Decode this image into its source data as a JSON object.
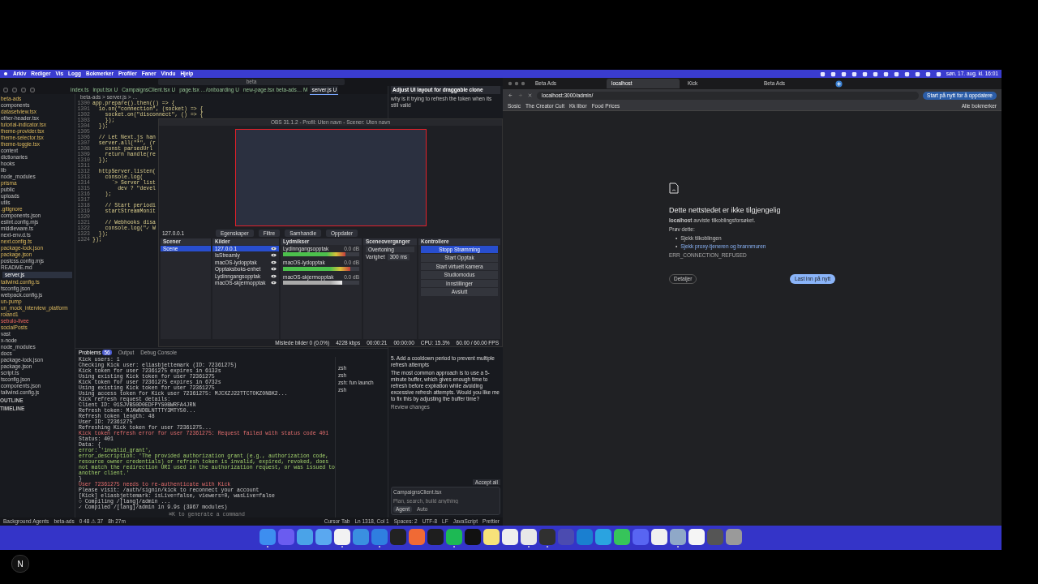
{
  "menubar": {
    "menus": [
      "Arkiv",
      "Rediger",
      "Vis",
      "Logg",
      "Bokmerker",
      "Profiler",
      "Faner",
      "Vindu",
      "Hjelp"
    ],
    "clock": "søn. 17. aug. kl. 16:01"
  },
  "editor": {
    "search": "beta",
    "tabs": [
      {
        "label": "index.ts",
        "selected": false
      },
      {
        "label": "input.tsx U",
        "selected": false
      },
      {
        "label": "CampaignsClient.tsx U",
        "selected": false
      },
      {
        "label": "page.tsx …/onboarding U",
        "selected": false
      },
      {
        "label": "new-page.tsx beta-ads… M",
        "selected": false
      },
      {
        "label": "server.js U",
        "selected": true
      }
    ],
    "breadcrumb": "beta-ads > server.js > …",
    "files": [
      {
        "name": "beta-ads",
        "kind": "modified"
      },
      {
        "name": "components",
        "kind": "plain"
      },
      {
        "name": "datasetview.tsx",
        "kind": "modified"
      },
      {
        "name": "other-header.tsx",
        "kind": "plain"
      },
      {
        "name": "tutorial-indicator.tsx",
        "kind": "modified"
      },
      {
        "name": "theme-provider.tsx",
        "kind": "modified"
      },
      {
        "name": "theme-selector.tsx",
        "kind": "modified"
      },
      {
        "name": "theme-toggle.tsx",
        "kind": "modified"
      },
      {
        "name": "context",
        "kind": "plain"
      },
      {
        "name": "dictionaries",
        "kind": "plain"
      },
      {
        "name": "hooks",
        "kind": "plain"
      },
      {
        "name": "lib",
        "kind": "plain"
      },
      {
        "name": "node_modules",
        "kind": "plain"
      },
      {
        "name": "prisma",
        "kind": "modified"
      },
      {
        "name": "public",
        "kind": "plain"
      },
      {
        "name": "uploads",
        "kind": "plain"
      },
      {
        "name": "utils",
        "kind": "plain"
      },
      {
        "name": ".gitignore",
        "kind": "modified"
      },
      {
        "name": "components.json",
        "kind": "plain"
      },
      {
        "name": "eslint.config.mjs",
        "kind": "plain"
      },
      {
        "name": "middleware.ts",
        "kind": "plain"
      },
      {
        "name": "next-env.d.ts",
        "kind": "plain"
      },
      {
        "name": "next.config.ts",
        "kind": "modified"
      },
      {
        "name": "package-lock.json",
        "kind": "modified"
      },
      {
        "name": "package.json",
        "kind": "modified"
      },
      {
        "name": "postcss.config.mjs",
        "kind": "plain"
      },
      {
        "name": "README.md",
        "kind": "plain"
      },
      {
        "name": "server.js",
        "kind": "selected"
      },
      {
        "name": "tailwind.config.ts",
        "kind": "modified"
      },
      {
        "name": "tsconfig.json",
        "kind": "plain"
      },
      {
        "name": "webpack.config.js",
        "kind": "plain"
      },
      {
        "name": "un-pump",
        "kind": "modified"
      },
      {
        "name": "un_mock_interview_platform",
        "kind": "modified"
      },
      {
        "name": "roland1",
        "kind": "modified"
      },
      {
        "name": "sebulo-livee",
        "kind": "error"
      },
      {
        "name": "socialPosts",
        "kind": "modified"
      },
      {
        "name": "vast",
        "kind": "plain"
      },
      {
        "name": "x-node",
        "kind": "plain"
      },
      {
        "name": "node_modules",
        "kind": "plain"
      },
      {
        "name": "docs",
        "kind": "plain"
      },
      {
        "name": "package-lock.json",
        "kind": "plain"
      },
      {
        "name": "package.json",
        "kind": "plain"
      },
      {
        "name": "script.ts",
        "kind": "plain"
      },
      {
        "name": "tsconfig.json",
        "kind": "plain"
      },
      {
        "name": "components.json",
        "kind": "plain"
      },
      {
        "name": "tailwind.config.js",
        "kind": "plain"
      }
    ],
    "sections": [
      "OUTLINE",
      "TIMELINE"
    ],
    "code": [
      {
        "no": "1300",
        "text": "app.prepare().then(() => {"
      },
      {
        "no": "1301",
        "text": "  io.on(\"connection\", (socket) => {"
      },
      {
        "no": "1302",
        "text": "    socket.on(\"disconnect\", () => {"
      },
      {
        "no": "1303",
        "text": "    });"
      },
      {
        "no": "1304",
        "text": "  });"
      },
      {
        "no": "1305"
      },
      {
        "no": "1306",
        "text": "  // Let Next.js han"
      },
      {
        "no": "1307",
        "text": "  server.all(\"*\", (r"
      },
      {
        "no": "1308",
        "text": "    const parsedUrl"
      },
      {
        "no": "1309",
        "text": "    return handle(re"
      },
      {
        "no": "1310",
        "text": "  });"
      },
      {
        "no": "1311"
      },
      {
        "no": "1312",
        "text": "  httpServer.listen("
      },
      {
        "no": "1313",
        "text": "    console.log("
      },
      {
        "no": "1314",
        "text": "      `> Server list"
      },
      {
        "no": "1315",
        "text": "        dev ? \"devel"
      },
      {
        "no": "1316",
        "text": "    );"
      },
      {
        "no": "1317"
      },
      {
        "no": "1318",
        "text": "    // Start periodi"
      },
      {
        "no": "1319",
        "text": "    startStreamMonit"
      },
      {
        "no": "1320"
      },
      {
        "no": "1321",
        "text": "    // Webhooks disa"
      },
      {
        "no": "1322",
        "text": "    console.log(\"✓ W"
      },
      {
        "no": "1323",
        "text": "  });"
      },
      {
        "no": "1324",
        "text": "});"
      }
    ],
    "panel_tabs": [
      {
        "label": "Problems",
        "selected": true,
        "badge": "56"
      },
      {
        "label": "Output",
        "selected": false
      },
      {
        "label": "Debug Console",
        "selected": false
      }
    ],
    "terminal": [
      {
        "kind": "plain",
        "text": "Kick users: 1"
      },
      {
        "kind": "plain",
        "text": "Checking Kick user: eliasbjettemark (ID: 72361275)"
      },
      {
        "kind": "plain",
        "text": "Kick token for user 72361275 expires in 6132s"
      },
      {
        "kind": "plain",
        "text": "Using existing Kick token for user 72361275"
      },
      {
        "kind": "plain",
        "text": "Kick token for user 72361275 expires in 6732s"
      },
      {
        "kind": "plain",
        "text": "Using existing Kick token for user 72361275"
      },
      {
        "kind": "plain",
        "text": "Using access token for Kick user 72361275: MJCXZJ22TTCTOKZ0N8K2..."
      },
      {
        "kind": "plain",
        "text": "Kick refresh request details:"
      },
      {
        "kind": "plain",
        "text": "  Client ID: 01SJVBS0D0EDFPYS0BWRFA4JRN"
      },
      {
        "kind": "plain",
        "text": "  Refresh token: MJAWNDBLNTTTY3MTY50..."
      },
      {
        "kind": "plain",
        "text": "  Refresh token length: 48"
      },
      {
        "kind": "plain",
        "text": "  User ID: 72361275"
      },
      {
        "kind": "plain",
        "text": "Refreshing Kick token for user 72361275..."
      },
      {
        "kind": "error",
        "text": "Kick token refresh error for user 72361275: Request failed with status code 401"
      },
      {
        "kind": "plain",
        "text": "  Status: 401"
      },
      {
        "kind": "plain",
        "text": "  Data: {"
      },
      {
        "kind": "string",
        "text": "  error: 'invalid_grant',"
      },
      {
        "kind": "string",
        "text": "  error_description: 'The provided authorization grant (e.g., authorization code, resource owner credentials) or refresh token is invalid, expired, revoked, does not match the redirection URI used in the authorization request, or was issued to another client.'"
      },
      {
        "kind": "plain",
        "text": "}"
      },
      {
        "kind": "error",
        "text": "User 72361275 needs to re-authenticate with Kick"
      },
      {
        "kind": "plain",
        "text": "Please visit: /auth/signin/kick to reconnect your account"
      },
      {
        "kind": "plain",
        "text": "[Kick] eliasbjettemark: isLive=false, viewers=0, wasLive=false"
      },
      {
        "kind": "plain",
        "text": "○ Compiling /[lang]/admin ..."
      },
      {
        "kind": "plain",
        "text": "✓ Compiled /[lang]/admin in 9.9s (3967 modules)"
      }
    ],
    "terminal_hint": "⌘K to generate a command",
    "shells": [
      "zsh",
      "zsh",
      "zsh: fun launch",
      "zsh"
    ],
    "chat": {
      "title": "Adjust UI layout for draggable clone",
      "question": "why is it trying to refresh the token when its still valid",
      "step": "5. Add a cooldown period to prevent multiple refresh attempts",
      "answer": "The most common approach is to use a 5-minute buffer, which gives enough time to refresh before expiration while avoiding excessive refresh attempts. Would you like me to fix this by adjusting the buffer time?",
      "review": "Review changes",
      "file": "CampaignsClient.tsx",
      "placeholder": "Plan, search, build anything",
      "mode": "Agent",
      "model": "Auto",
      "accept": "Accept all"
    },
    "status": {
      "left": [
        "Background Agents",
        "beta-ads",
        "0 48 ⚠ 37",
        "8h 27m"
      ],
      "right": [
        "Cursor Tab",
        "Ln 1318, Col 1",
        "Spaces: 2",
        "UTF-8",
        "LF",
        "JavaScript",
        "Prettier"
      ]
    }
  },
  "obs": {
    "title": "OBS 31.1.2 - Profil: Uten navn - Scener: Uten navn",
    "source": "127.0.0.1",
    "toolbar": [
      "Egenskaper",
      "Filtre",
      "Samhandle",
      "Oppdater"
    ],
    "scenes": {
      "title": "Scener",
      "items": [
        {
          "label": "Scene",
          "selected": true
        }
      ]
    },
    "sources": {
      "title": "Kilder",
      "items": [
        {
          "label": "127.0.0.1",
          "selected": true
        },
        {
          "label": "IsStreamly",
          "selected": false
        },
        {
          "label": "macOS-lydopptak",
          "selected": false
        },
        {
          "label": "Opptaksboks-enhet",
          "selected": false
        },
        {
          "label": "Lydinngangsopptak",
          "selected": false
        },
        {
          "label": "macOS-skjermopptak",
          "selected": false
        }
      ]
    },
    "mixer": {
      "title": "Lydmikser",
      "channels": [
        {
          "name": "Lydinngangsopptak",
          "reading": "0.0 dB",
          "level": 0.82,
          "muted": false
        },
        {
          "name": "macOS-lydopptak",
          "reading": "0.0 dB",
          "level": 0.88,
          "muted": false
        },
        {
          "name": "macOS-skjermopptak",
          "reading": "0.0 dB",
          "level": 0.78,
          "muted": true
        }
      ]
    },
    "transitions": {
      "title": "Sceneoverganger",
      "value": "Overtoning",
      "duration_label": "Varighet",
      "duration": "300 ms"
    },
    "controls": {
      "title": "Kontrollere",
      "buttons": [
        {
          "label": "Stopp Strømming",
          "selected": true
        },
        {
          "label": "Start Opptak",
          "selected": false
        },
        {
          "label": "Start virtuelt kamera",
          "selected": false
        },
        {
          "label": "Studiomodus",
          "selected": false
        },
        {
          "label": "Innstillinger",
          "selected": false
        },
        {
          "label": "Avslutt",
          "selected": false
        }
      ]
    },
    "stats": [
      "Mistede bilder 0 (0.0%)",
      "4228 kbps",
      "00:00:21",
      "00:00:00",
      "CPU: 15.3%",
      "60.00 / 60.00 FPS"
    ]
  },
  "browser": {
    "tabs": [
      {
        "label": "Beta Ads",
        "selected": false
      },
      {
        "label": "localhost",
        "selected": true
      },
      {
        "label": "Kick",
        "selected": false
      },
      {
        "label": "Beta Ads",
        "selected": false
      }
    ],
    "url": "localhost:3000/admin/",
    "update": "Start på nytt for å oppdatere",
    "bookmarks": [
      "Sosic",
      "The Creator Cult",
      "Kk libor",
      "Food Prices"
    ],
    "all_bookmarks": "Alle bokmerker",
    "error": {
      "title": "Dette nettstedet er ikke tilgjengelig",
      "message": "**localhost** avviste tilkoblingsforsøket.",
      "try": "Prøv dette:",
      "bullet": "•",
      "tips": [
        {
          "text": "Sjekk tilkoblingen",
          "link": false
        },
        {
          "text": "Sjekk proxy-tjeneren og brannmuren",
          "link": true
        }
      ],
      "code": "ERR_CONNECTION_REFUSED",
      "details": "Detaljer",
      "reload": "Last inn på nytt"
    }
  },
  "dock": [
    {
      "color": "#3d8ef0",
      "running": true
    },
    {
      "color": "#6a5cf0",
      "running": false
    },
    {
      "color": "#4aa3e8",
      "running": false
    },
    {
      "color": "#5aa8f0",
      "running": false
    },
    {
      "color": "#f2f2f2",
      "running": true
    },
    {
      "color": "#3a8fe0",
      "running": false
    },
    {
      "color": "#2f7fe0",
      "running": true
    },
    {
      "color": "#222222",
      "running": false
    },
    {
      "color": "#f06a35",
      "running": false
    },
    {
      "color": "#1e1e1e",
      "running": false
    },
    {
      "color": "#1db954",
      "running": true
    },
    {
      "color": "#111111",
      "running": false
    },
    {
      "color": "#f7e27a",
      "running": false
    },
    {
      "color": "#eeeeee",
      "running": false
    },
    {
      "color": "#e8e8e8",
      "running": true
    },
    {
      "color": "#303030",
      "running": true
    },
    {
      "color": "#4b4bb0",
      "running": false
    },
    {
      "color": "#1a7fd0",
      "running": false
    },
    {
      "color": "#2aa3e0",
      "running": false
    },
    {
      "color": "#36c45a",
      "running": false
    },
    {
      "color": "#5865f2",
      "running": false
    },
    {
      "color": "#f0f0f0",
      "running": false
    },
    {
      "color": "#8fa8c8",
      "running": true
    },
    {
      "color": "#f5f5f5",
      "running": false
    },
    {
      "color": "#555555",
      "running": false
    },
    {
      "color": "#9a9a9a",
      "running": false
    }
  ],
  "corner_badge": "N"
}
